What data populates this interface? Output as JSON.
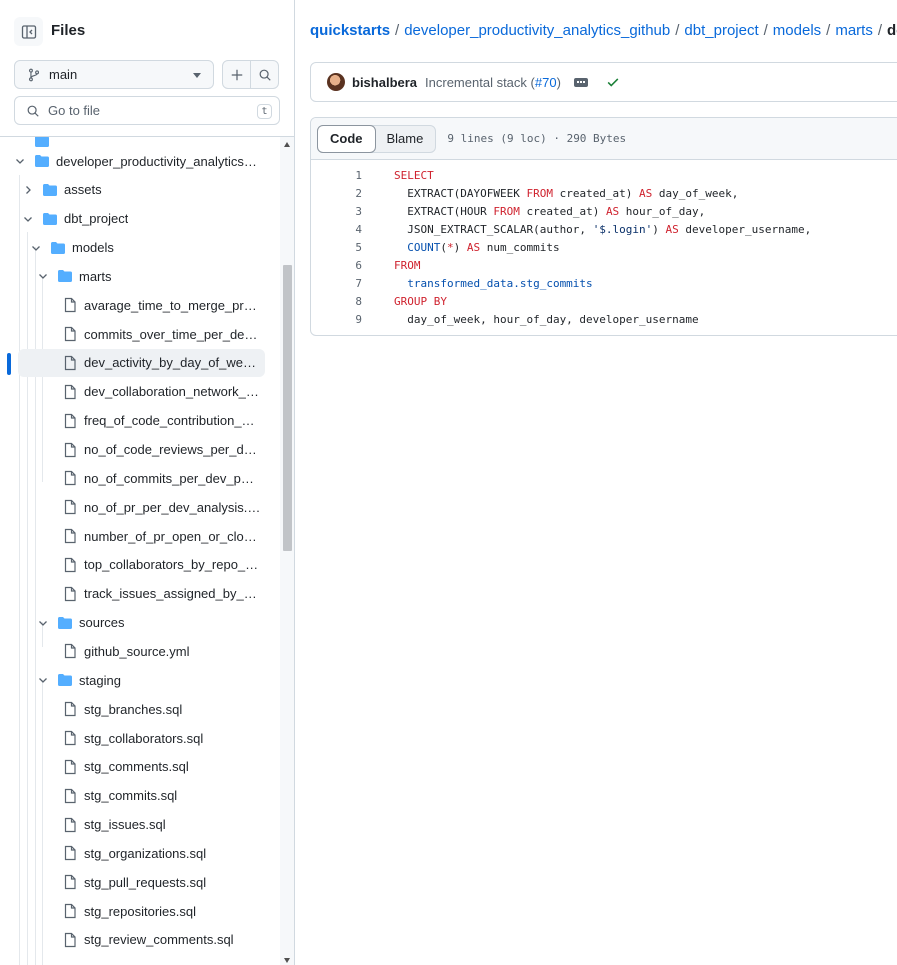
{
  "sidebar": {
    "title": "Files",
    "branch": "main",
    "goto_placeholder": "Go to file",
    "goto_shortcut": "t",
    "tree": [
      {
        "label": "developer_productivity_analytics…",
        "type": "folder",
        "expanded": true
      },
      {
        "label": "assets",
        "type": "folder",
        "expanded": false
      },
      {
        "label": "dbt_project",
        "type": "folder",
        "expanded": true
      },
      {
        "label": "models",
        "type": "folder",
        "expanded": true
      },
      {
        "label": "marts",
        "type": "folder",
        "expanded": true
      },
      {
        "label": "avarage_time_to_merge_pr…",
        "type": "file"
      },
      {
        "label": "commits_over_time_per_de…",
        "type": "file"
      },
      {
        "label": "dev_activity_by_day_of_we…",
        "type": "file",
        "active": true
      },
      {
        "label": "dev_collaboration_network_…",
        "type": "file"
      },
      {
        "label": "freq_of_code_contribution_…",
        "type": "file"
      },
      {
        "label": "no_of_code_reviews_per_d…",
        "type": "file"
      },
      {
        "label": "no_of_commits_per_dev_p…",
        "type": "file"
      },
      {
        "label": "no_of_pr_per_dev_analysis.…",
        "type": "file"
      },
      {
        "label": "number_of_pr_open_or_clo…",
        "type": "file"
      },
      {
        "label": "top_collaborators_by_repo_…",
        "type": "file"
      },
      {
        "label": "track_issues_assigned_by_…",
        "type": "file"
      },
      {
        "label": "sources",
        "type": "folder",
        "expanded": true
      },
      {
        "label": "github_source.yml",
        "type": "file"
      },
      {
        "label": "staging",
        "type": "folder",
        "expanded": true
      },
      {
        "label": "stg_branches.sql",
        "type": "file"
      },
      {
        "label": "stg_collaborators.sql",
        "type": "file"
      },
      {
        "label": "stg_comments.sql",
        "type": "file"
      },
      {
        "label": "stg_commits.sql",
        "type": "file"
      },
      {
        "label": "stg_issues.sql",
        "type": "file"
      },
      {
        "label": "stg_organizations.sql",
        "type": "file"
      },
      {
        "label": "stg_pull_requests.sql",
        "type": "file"
      },
      {
        "label": "stg_repositories.sql",
        "type": "file"
      },
      {
        "label": "stg_review_comments.sql",
        "type": "file"
      }
    ]
  },
  "breadcrumb": {
    "root": "quickstarts",
    "parts": [
      "developer_productivity_analytics_github",
      "dbt_project",
      "models",
      "marts"
    ],
    "current": "dev_ac",
    "separator": "/"
  },
  "commit": {
    "author": "bishalbera",
    "message": "Incremental stack (",
    "pr": "#70",
    "message_end": ")"
  },
  "code": {
    "tabs": [
      "Code",
      "Blame"
    ],
    "active_tab": "Code",
    "info": "9 lines (9 loc) · 290 Bytes",
    "lines": [
      [
        {
          "t": "SELECT",
          "c": "kw"
        }
      ],
      [
        {
          "t": "  EXTRACT(DAYOFWEEK ",
          "c": ""
        },
        {
          "t": "FROM",
          "c": "kw"
        },
        {
          "t": " created_at) ",
          "c": ""
        },
        {
          "t": "AS",
          "c": "kw"
        },
        {
          "t": " day_of_week,",
          "c": ""
        }
      ],
      [
        {
          "t": "  EXTRACT(HOUR ",
          "c": ""
        },
        {
          "t": "FROM",
          "c": "kw"
        },
        {
          "t": " created_at) ",
          "c": ""
        },
        {
          "t": "AS",
          "c": "kw"
        },
        {
          "t": " hour_of_day,",
          "c": ""
        }
      ],
      [
        {
          "t": "  JSON_EXTRACT_SCALAR(author, ",
          "c": ""
        },
        {
          "t": "'$.login'",
          "c": "str"
        },
        {
          "t": ") ",
          "c": ""
        },
        {
          "t": "AS",
          "c": "kw"
        },
        {
          "t": " developer_username,",
          "c": ""
        }
      ],
      [
        {
          "t": "  ",
          "c": ""
        },
        {
          "t": "COUNT",
          "c": "id"
        },
        {
          "t": "(",
          "c": ""
        },
        {
          "t": "*",
          "c": "kw"
        },
        {
          "t": ") ",
          "c": ""
        },
        {
          "t": "AS",
          "c": "kw"
        },
        {
          "t": " num_commits",
          "c": ""
        }
      ],
      [
        {
          "t": "FROM",
          "c": "kw"
        }
      ],
      [
        {
          "t": "  transformed_data.stg_commits",
          "c": "id"
        }
      ],
      [
        {
          "t": "GROUP BY",
          "c": "kw"
        }
      ],
      [
        {
          "t": "  day_of_week, hour_of_day, developer_username",
          "c": ""
        }
      ]
    ]
  },
  "colors": {
    "accent": "#0969da",
    "keyword": "#cf222e",
    "success": "#1a7f37"
  }
}
